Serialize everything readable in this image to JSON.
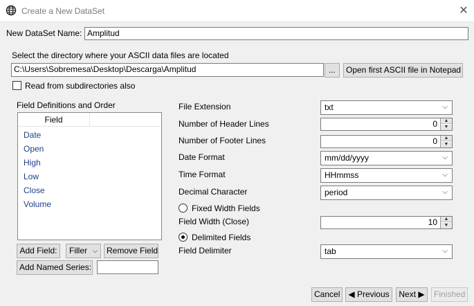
{
  "window": {
    "title": "Create a New DataSet",
    "icon": "globe-icon",
    "close_icon": "close-icon"
  },
  "dataset_name": {
    "label": "New DataSet Name:",
    "value": "Amplitud"
  },
  "directory": {
    "prompt": "Select the directory where your ASCII data files are located",
    "path": "C:\\Users\\Sobremesa\\Desktop\\Descarga\\Amplitud",
    "browse_label": "...",
    "notepad_label": "Open first ASCII file in Notepad",
    "subdirs_label": "Read from subdirectories also",
    "subdirs_checked": false
  },
  "fields": {
    "heading": "Field Definitions and Order",
    "column_header": "Field",
    "items": [
      "Date",
      "Open",
      "High",
      "Low",
      "Close",
      "Volume"
    ],
    "add_field_label": "Add Field:",
    "filler_label": "Filler",
    "remove_field_label": "Remove Field",
    "add_named_series_label": "Add Named Series:",
    "named_series_value": ""
  },
  "settings": {
    "file_extension": {
      "label": "File Extension",
      "value": "txt"
    },
    "header_lines": {
      "label": "Number of Header Lines",
      "value": "0"
    },
    "footer_lines": {
      "label": "Number of Footer Lines",
      "value": "0"
    },
    "date_format": {
      "label": "Date Format",
      "value": "mm/dd/yyyy"
    },
    "time_format": {
      "label": "Time Format",
      "value": "HHmmss"
    },
    "decimal_char": {
      "label": "Decimal Character",
      "value": "period"
    },
    "fixed_width": {
      "label": "Fixed Width Fields",
      "selected": false
    },
    "field_width": {
      "label": "Field Width (Close)",
      "value": "10"
    },
    "delimited": {
      "label": "Delimited Fields",
      "selected": true
    },
    "field_delimiter": {
      "label": "Field Delimiter",
      "value": "tab"
    }
  },
  "footer": {
    "cancel": "Cancel",
    "previous": "Previous",
    "next": "Next",
    "finished": "Finished"
  }
}
